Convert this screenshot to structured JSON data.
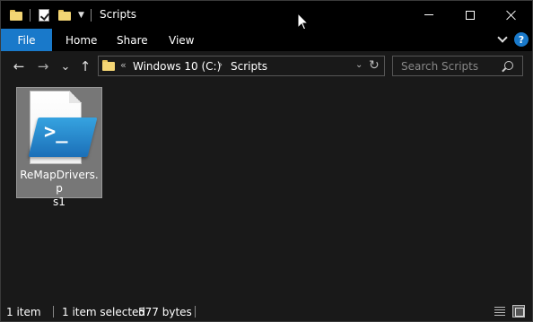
{
  "window": {
    "title": "Scripts",
    "controls": {
      "minimize": "minimize-icon",
      "maximize": "maximize-icon",
      "close": "close-icon"
    }
  },
  "quick_access": {
    "icons": [
      "folder-icon",
      "properties-check-icon",
      "new-folder-icon",
      "customize-caret-icon"
    ]
  },
  "ribbon": {
    "file_label": "File",
    "tabs": [
      {
        "label": "Home"
      },
      {
        "label": "Share"
      },
      {
        "label": "View"
      }
    ],
    "help_label": "?"
  },
  "navigation": {
    "back": "←",
    "forward": "→",
    "recent": "⌄",
    "up": "↑",
    "address": {
      "overflow": "«",
      "breadcrumbs": [
        {
          "label": "Windows 10 (C:)"
        },
        {
          "label": "Scripts"
        }
      ],
      "separator": "›",
      "refresh": "↻"
    },
    "search": {
      "placeholder": "Search Scripts"
    }
  },
  "files": [
    {
      "name": "ReMapDrivers.ps1",
      "name_wrapped_line1": "ReMapDrivers.p",
      "name_wrapped_line2": "s1",
      "icon": "powershell-script-icon",
      "selected": true,
      "badge_text": ">_"
    }
  ],
  "status": {
    "count": "1 item",
    "selected": "1 item selected",
    "size": "577 bytes"
  },
  "colors": {
    "accent": "#1979ca",
    "background": "#191919",
    "titlebar": "#000000",
    "selection": "#777777"
  }
}
